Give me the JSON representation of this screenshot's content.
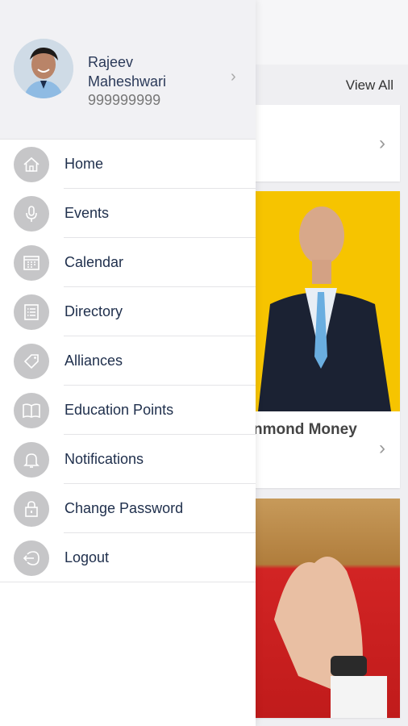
{
  "background": {
    "view_all_label": "View All",
    "featured_caption": "nmond Money"
  },
  "profile": {
    "name": "Rajeev Maheshwari",
    "phone": "999999999"
  },
  "menu": [
    {
      "label": "Home",
      "icon": "home-icon"
    },
    {
      "label": "Events",
      "icon": "microphone-icon"
    },
    {
      "label": "Calendar",
      "icon": "calendar-icon"
    },
    {
      "label": "Directory",
      "icon": "list-icon"
    },
    {
      "label": "Alliances",
      "icon": "tag-icon"
    },
    {
      "label": "Education Points",
      "icon": "book-icon"
    },
    {
      "label": "Notifications",
      "icon": "bell-icon"
    },
    {
      "label": "Change Password",
      "icon": "lock-icon"
    },
    {
      "label": "Logout",
      "icon": "logout-icon"
    }
  ],
  "colors": {
    "drawer_header_bg": "#f1f1f4",
    "icon_circle": "#c6c6c8",
    "menu_text": "#20304d",
    "featured_bg": "#f6c400"
  }
}
